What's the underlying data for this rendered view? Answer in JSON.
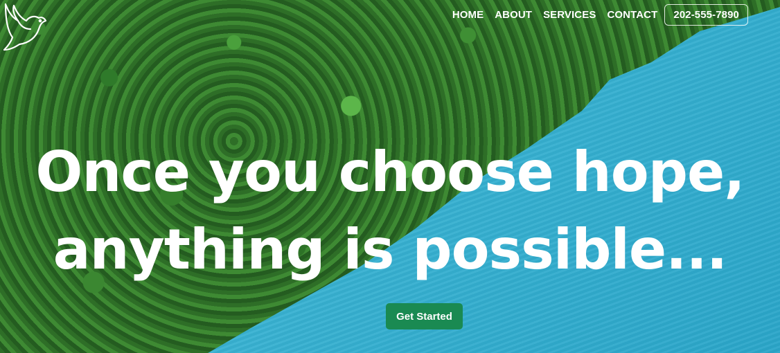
{
  "nav": {
    "items": [
      {
        "label": "HOME"
      },
      {
        "label": "ABOUT"
      },
      {
        "label": "SERVICES"
      },
      {
        "label": "CONTACT"
      }
    ],
    "phone": "202-555-7890"
  },
  "hero": {
    "headline_line1": "Once you choose hope,",
    "headline_line2": "anything is possible...",
    "cta_label": "Get Started"
  },
  "colors": {
    "cta": "#1a8a52",
    "water": "#3ab3d3",
    "forest": "#2f6f29",
    "text": "#ffffff"
  },
  "icons": {
    "logo": "dove-icon"
  }
}
